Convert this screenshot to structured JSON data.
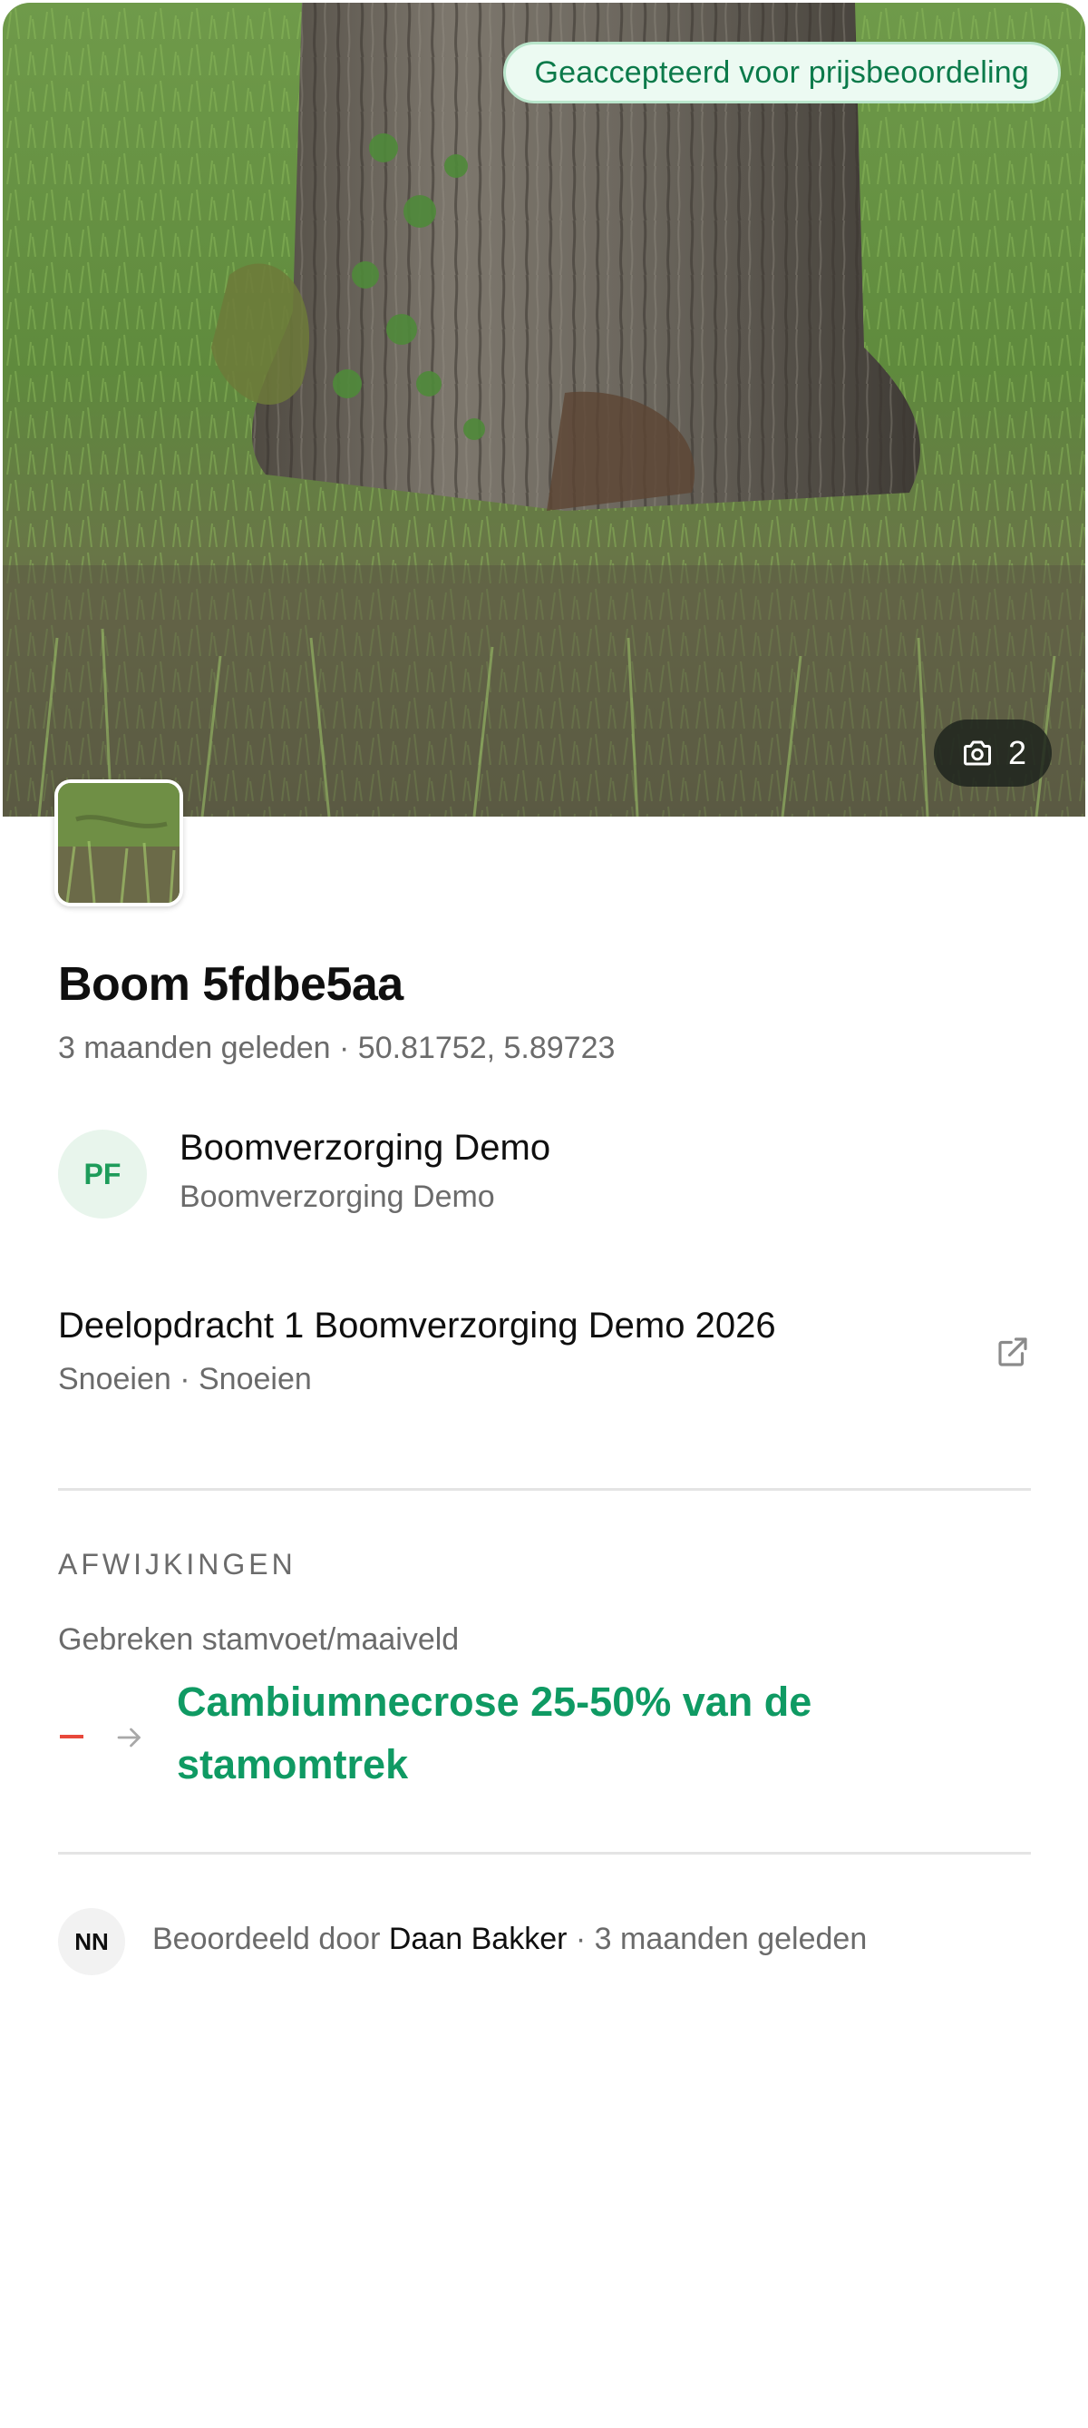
{
  "photo": {
    "status_badge": "Geaccepteerd voor prijsbeoordeling",
    "photo_count": "2"
  },
  "tree": {
    "title": "Boom 5fdbe5aa",
    "meta": "3 maanden geleden · 50.81752, 5.89723"
  },
  "organization": {
    "initials": "PF",
    "name": "Boomverzorging Demo",
    "subtitle": "Boomverzorging Demo"
  },
  "assignment": {
    "title": "Deelopdracht 1 Boomverzorging Demo 2026",
    "subtitle": "Snoeien · Snoeien"
  },
  "deviations": {
    "section_label": "AFWIJKINGEN",
    "category": "Gebreken stamvoet/maaiveld",
    "old_value": "–",
    "new_value": "Cambiumnecrose 25-50% van de stamomtrek"
  },
  "review": {
    "initials": "NN",
    "prefix": "Beoordeeld door",
    "reviewer": "Daan Bakker",
    "suffix": "· 3 maanden geleden"
  },
  "colors": {
    "accent_green": "#0f9a63",
    "badge_bg": "#ecfaf2",
    "removed_red": "#e8483b",
    "muted_text": "#6b6b6b"
  },
  "icons": {
    "photo_count": "camera-icon",
    "assignment_link": "external-link-icon",
    "change_arrow": "arrow-right-icon"
  }
}
